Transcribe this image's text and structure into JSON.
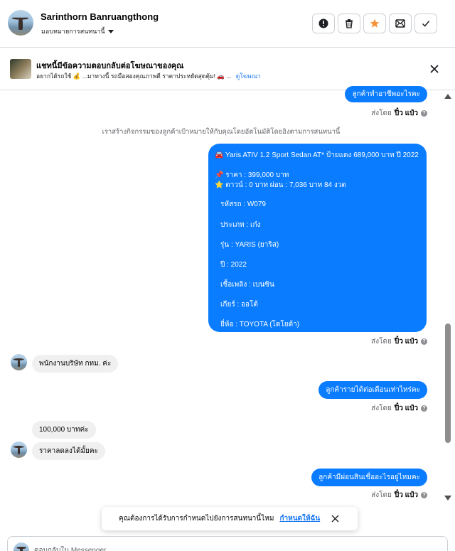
{
  "header": {
    "contact_name": "Sarinthorn Banruangthong",
    "assign_label": "มอบหมายการสนทนานี้",
    "actions": [
      {
        "name": "mark-spam-button",
        "icon": "alert-icon"
      },
      {
        "name": "delete-button",
        "icon": "trash-icon"
      },
      {
        "name": "star-button",
        "icon": "star-icon",
        "color": "#f7b928"
      },
      {
        "name": "mark-unread-button",
        "icon": "envelope-icon"
      },
      {
        "name": "mark-done-button",
        "icon": "check-icon"
      }
    ]
  },
  "ad_banner": {
    "title": "แชทนี้มีข้อความตอบกลับต่อโฆษณาของคุณ",
    "subtitle": "อยากได้รถใช้ 💰 ...มาทางนี้ รถมือสองคุณภาพดี ราคาประหยัดสุดคุ้ม! 🚗 ...",
    "link": "ดูโฆษณา"
  },
  "messages": {
    "out_top": "ลูกค้าทำอาชีพอะไรคะ",
    "sent_by_prefix": "ส่งโดย",
    "sent_by_name": "ปิ๋ว แป๋ว",
    "system_notice": "เราสร้างกิจกรรมของลูกค้าเป้าหมายให้กับคุณโดยอัตโนมัติโดยอิงตามการสนทนานี้",
    "car": {
      "title": "🚘 Yaris ATIV 1.2 Sport Sedan AT* ป้ายแดง 689,000 บาท ปี 2022",
      "price": "📌 ราคา : 399,000 บาท",
      "down": "⭐ ดาวน์ : 0 บาท ผ่อน : 7,036 บาท 84 งวด",
      "code": "รหัสรถ : W079",
      "type": "ประเภท : เก๋ง",
      "model": "รุ่น : YARIS (ยาริส)",
      "year": "ปี : 2022",
      "fuel": "เชื้อเพลิง : เบนซิน",
      "gear": "เกียร์ : ออโต้",
      "brand": "ยี่ห้อ : TOYOTA (โตโยต้า)"
    },
    "in_job": "พนักงานบริษัท  กทม. ค่ะ",
    "out_income": "ลูกค้ารายได้ต่อเดือนเท่าไหร่คะ",
    "in_income": "100,000 บาทค่ะ",
    "in_discount": "ราคาลดลงได้มั้ยคะ",
    "out_loan": "ลูกค้ามีผ่อนสินเชื่ออะไรอยู่ไหมคะ"
  },
  "toast": {
    "text": "คุณต้องการได้รับการกำหนดไปยังการสนทนานี้ไหม",
    "link": "กำหนดให้ฉัน"
  },
  "composer": {
    "placeholder": "ตอบกลับใน Messenger"
  },
  "colors": {
    "outgoing_bubble": "#0a7cff",
    "incoming_bubble": "#f0f0f0",
    "link": "#1877f2"
  }
}
